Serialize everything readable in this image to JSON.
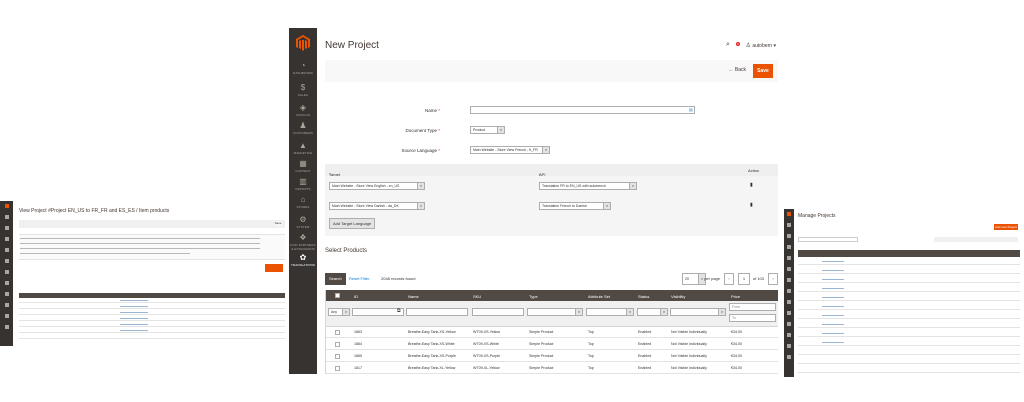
{
  "left_panel": {
    "title": "View Project #Project EN_US to FR_FR and ES_ES / Item products",
    "button_label": "Save"
  },
  "right_panel": {
    "title": "Manage Projects",
    "add_button_label": "Add new Project"
  },
  "sidebar": {
    "items": [
      {
        "label": "DASHBOARD",
        "icon": "dashboard-icon"
      },
      {
        "label": "SALES",
        "icon": "dollar-icon"
      },
      {
        "label": "CATALOG",
        "icon": "cube-icon"
      },
      {
        "label": "CUSTOMERS",
        "icon": "person-icon"
      },
      {
        "label": "MARKETING",
        "icon": "megaphone-icon"
      },
      {
        "label": "CONTENT",
        "icon": "layout-icon"
      },
      {
        "label": "REPORTS",
        "icon": "bar-chart-icon"
      },
      {
        "label": "STORES",
        "icon": "store-icon"
      },
      {
        "label": "SYSTEM",
        "icon": "gear-icon"
      },
      {
        "label": "FIND PARTNERS & EXTENSIONS",
        "icon": "puzzle-icon"
      },
      {
        "label": "TRANSLATIONS",
        "icon": "translations-icon"
      }
    ]
  },
  "header": {
    "title": "New Project",
    "user_name": "autobern",
    "notification_count": "4"
  },
  "actions": {
    "back_label": "Back",
    "save_label": "Save"
  },
  "form": {
    "name_label": "Name",
    "name_value": "",
    "document_type_label": "Document Type",
    "document_type_value": "Product",
    "source_language_label": "Source Language",
    "source_language_value": "Main Website - Store View French - fr_FR"
  },
  "target_table": {
    "headers": [
      "Target Language",
      "API Template",
      "Action"
    ],
    "rows": [
      {
        "language": "Main Website - Store View English - en_US",
        "template": "Translation FR to EN_US with autobench"
      },
      {
        "language": "Main Website - Store View Danish - da_DK",
        "template": "Translation French to Danish"
      }
    ],
    "add_button_label": "Add Target Language"
  },
  "products": {
    "section_title": "Select Products",
    "search_label": "Search",
    "reset_label": "Reset Filter",
    "records": "2048 records found",
    "per_page_value": "20",
    "per_page_label": "per page",
    "page_value": "1",
    "page_of": "of 103",
    "columns": [
      "ID",
      "Name",
      "SKU",
      "Type",
      "Attribute Set",
      "Status",
      "Visibility",
      "Price"
    ],
    "filter_any": "Any",
    "price_from_placeholder": "From",
    "price_to_placeholder": "To",
    "rows": [
      {
        "id": "1863",
        "name": "Breathe-Easy Tank-XS-Yellow",
        "sku": "WT09-XS-Yellow",
        "type": "Simple Product",
        "attribute_set": "Top",
        "status": "Enabled",
        "visibility": "Not Visible Individually",
        "price": "€34.00"
      },
      {
        "id": "1864",
        "name": "Breathe-Easy Tank-XS-White",
        "sku": "WT09-XS-White",
        "type": "Simple Product",
        "attribute_set": "Top",
        "status": "Enabled",
        "visibility": "Not Visible Individually",
        "price": "€34.00"
      },
      {
        "id": "1865",
        "name": "Breathe-Easy Tank-XS-Purple",
        "sku": "WT09-XS-Purple",
        "type": "Simple Product",
        "attribute_set": "Top",
        "status": "Enabled",
        "visibility": "Not Visible Individually",
        "price": "€34.00"
      },
      {
        "id": "1817",
        "name": "Breathe-Easy Tank-XL-Yellow",
        "sku": "WT09-XL-Yellow",
        "type": "Simple Product",
        "attribute_set": "Top",
        "status": "Enabled",
        "visibility": "Not Visible Individually",
        "price": "€34.00"
      }
    ]
  },
  "colors": {
    "sidebar": "#373330",
    "accent": "#eb5202",
    "grid_header": "#514943",
    "link": "#007bdb"
  }
}
